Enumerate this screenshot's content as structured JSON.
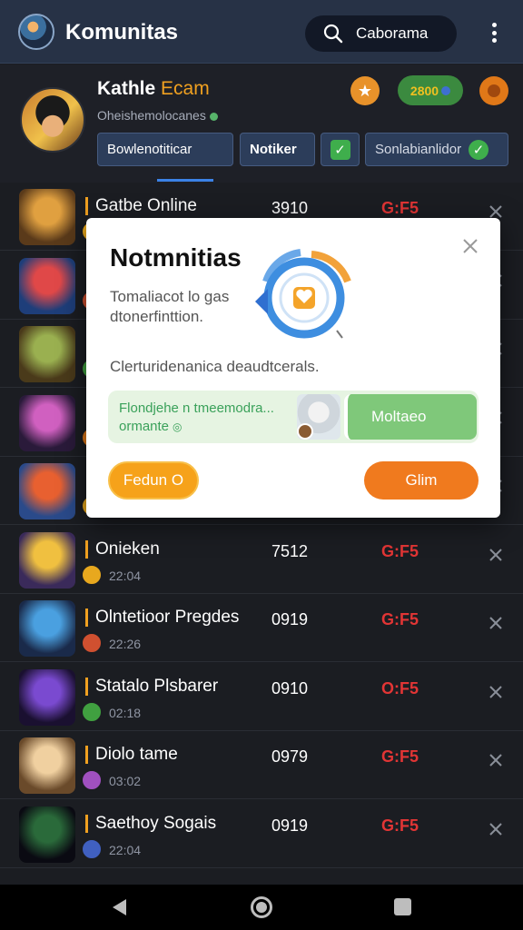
{
  "app_bar": {
    "title": "Komunitas",
    "search_label": "Caborama"
  },
  "profile": {
    "name": "Kathle",
    "name_accent": "Ecam",
    "subtitle": "Oheishemolocanes",
    "points": "2800",
    "chips": [
      "Bowlenotiticar",
      "Notiker",
      "",
      "Sonlabianlidor"
    ]
  },
  "modal": {
    "title": "Notmnitias",
    "description": "Tomaliacot lo gas dtonerfinttion.",
    "line": "Clerturidenanica deaudtcerals.",
    "card_text": "Flondjehe n tmeemodra... ormante",
    "card_button": "Moltaeo",
    "left_button": "Fedun O",
    "right_button": "Glim"
  },
  "list": {
    "rows": [
      {
        "name": "Gatbe Online",
        "time": "",
        "number": "3910",
        "status": "G:F5",
        "thumb_a": "#e0a040",
        "thumb_b": "#5a3a1a",
        "mini": "#e8a81e"
      },
      {
        "name": "",
        "time": "",
        "number": "",
        "status": "",
        "thumb_a": "#e04848",
        "thumb_b": "#1e3e7a",
        "mini": "#d05030"
      },
      {
        "name": "",
        "time": "",
        "number": "",
        "status": "",
        "thumb_a": "#9ab050",
        "thumb_b": "#4a3a1a",
        "mini": "#40a040"
      },
      {
        "name": "",
        "time": "",
        "number": "",
        "status": "",
        "thumb_a": "#d060c0",
        "thumb_b": "#2a1a3a",
        "mini": "#e07818"
      },
      {
        "name": "",
        "time": "",
        "number": "",
        "status": "",
        "thumb_a": "#e86030",
        "thumb_b": "#2a4a8a",
        "mini": "#e8a81e"
      },
      {
        "name": "Onieken",
        "time": "22:04",
        "number": "7512",
        "status": "G:F5",
        "thumb_a": "#f0c040",
        "thumb_b": "#3a2a5a",
        "mini": "#e8a81e"
      },
      {
        "name": "Olntetioor Pregdes",
        "time": "22:26",
        "number": "0919",
        "status": "G:F5",
        "thumb_a": "#4aa0e0",
        "thumb_b": "#1a2a4a",
        "mini": "#d05030"
      },
      {
        "name": "Statalo Plsbarer",
        "time": "02:18",
        "number": "0910",
        "status": "O:F5",
        "thumb_a": "#7a4ad0",
        "thumb_b": "#1a1030",
        "mini": "#40a040"
      },
      {
        "name": "Diolo tame",
        "time": "03:02",
        "number": "0979",
        "status": "G:F5",
        "thumb_a": "#f0d0a0",
        "thumb_b": "#6a4a2a",
        "mini": "#a050c0"
      },
      {
        "name": "Saethoy Sogais",
        "time": "22:04",
        "number": "0919",
        "status": "G:F5",
        "thumb_a": "#2a6a3a",
        "thumb_b": "#0a0a12",
        "mini": "#4060c0"
      }
    ]
  },
  "colors": {
    "app_bar": "#273246",
    "background": "#1b1d22",
    "accent_orange": "#f0a020",
    "status_red": "#e23535",
    "success_green": "#3fae4c"
  },
  "icons": [
    "search-icon",
    "more-vert-icon",
    "star-icon",
    "check-icon",
    "close-icon",
    "back-icon",
    "home-icon",
    "recents-icon"
  ]
}
